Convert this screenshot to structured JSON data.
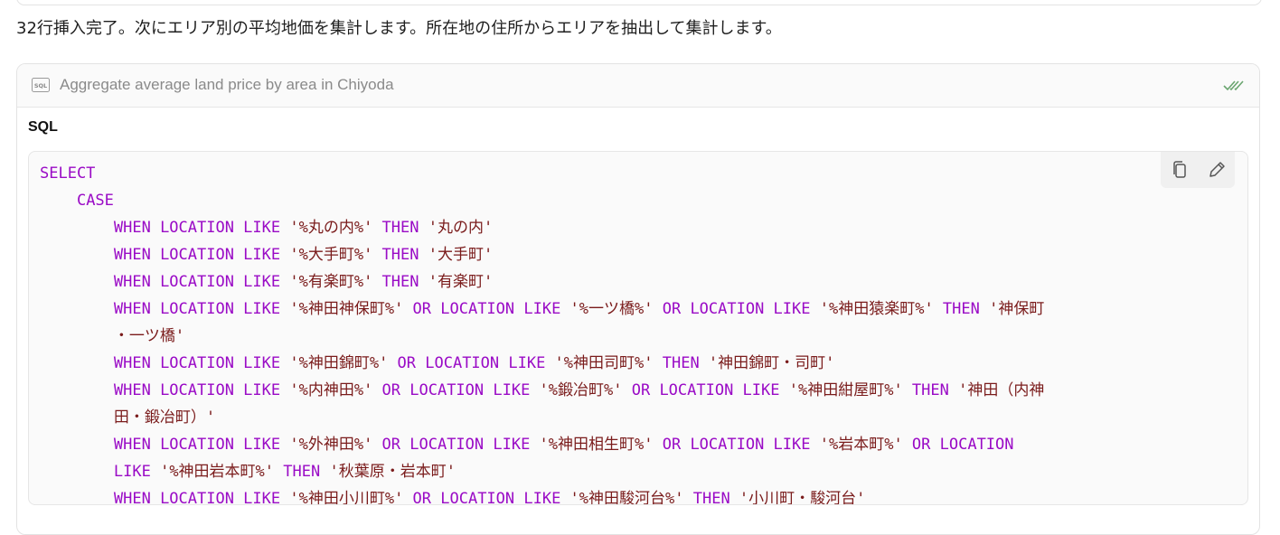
{
  "message": {
    "text": "32行挿入完了。次にエリア別の平均地価を集計します。所在地の住所からエリアを抽出して集計します。"
  },
  "tool_call": {
    "icon": "sql-icon",
    "title": "Aggregate average land price by area in Chiyoda",
    "status_icon": "double-check-icon",
    "section_label": "SQL",
    "actions": {
      "copy_icon": "copy-icon",
      "edit_icon": "edit-pencil-icon"
    }
  },
  "code": {
    "language": "SQL",
    "lines": [
      [
        {
          "t": "kw",
          "v": "SELECT"
        }
      ],
      [
        {
          "t": "kw",
          "v": "    CASE"
        }
      ],
      [
        {
          "t": "kw",
          "v": "        WHEN LOCATION LIKE "
        },
        {
          "t": "str",
          "v": "'%丸の内%'"
        },
        {
          "t": "kw",
          "v": " THEN "
        },
        {
          "t": "str",
          "v": "'丸の内'"
        }
      ],
      [
        {
          "t": "kw",
          "v": "        WHEN LOCATION LIKE "
        },
        {
          "t": "str",
          "v": "'%大手町%'"
        },
        {
          "t": "kw",
          "v": " THEN "
        },
        {
          "t": "str",
          "v": "'大手町'"
        }
      ],
      [
        {
          "t": "kw",
          "v": "        WHEN LOCATION LIKE "
        },
        {
          "t": "str",
          "v": "'%有楽町%'"
        },
        {
          "t": "kw",
          "v": " THEN "
        },
        {
          "t": "str",
          "v": "'有楽町'"
        }
      ],
      [
        {
          "t": "kw",
          "v": "        WHEN LOCATION LIKE "
        },
        {
          "t": "str",
          "v": "'%神田神保町%'"
        },
        {
          "t": "kw",
          "v": " OR LOCATION LIKE "
        },
        {
          "t": "str",
          "v": "'%一ツ橋%'"
        },
        {
          "t": "kw",
          "v": " OR LOCATION LIKE "
        },
        {
          "t": "str",
          "v": "'%神田猿楽町%'"
        },
        {
          "t": "kw",
          "v": " THEN "
        },
        {
          "t": "str",
          "v": "'神保町\n        ・一ツ橋'"
        }
      ],
      [
        {
          "t": "kw",
          "v": "        WHEN LOCATION LIKE "
        },
        {
          "t": "str",
          "v": "'%神田錦町%'"
        },
        {
          "t": "kw",
          "v": " OR LOCATION LIKE "
        },
        {
          "t": "str",
          "v": "'%神田司町%'"
        },
        {
          "t": "kw",
          "v": " THEN "
        },
        {
          "t": "str",
          "v": "'神田錦町・司町'"
        }
      ],
      [
        {
          "t": "kw",
          "v": "        WHEN LOCATION LIKE "
        },
        {
          "t": "str",
          "v": "'%内神田%'"
        },
        {
          "t": "kw",
          "v": " OR LOCATION LIKE "
        },
        {
          "t": "str",
          "v": "'%鍛冶町%'"
        },
        {
          "t": "kw",
          "v": " OR LOCATION LIKE "
        },
        {
          "t": "str",
          "v": "'%神田紺屋町%'"
        },
        {
          "t": "kw",
          "v": " THEN "
        },
        {
          "t": "str",
          "v": "'神田（内神\n        田・鍛冶町）'"
        }
      ],
      [
        {
          "t": "kw",
          "v": "        WHEN LOCATION LIKE "
        },
        {
          "t": "str",
          "v": "'%外神田%'"
        },
        {
          "t": "kw",
          "v": " OR LOCATION LIKE "
        },
        {
          "t": "str",
          "v": "'%神田相生町%'"
        },
        {
          "t": "kw",
          "v": " OR LOCATION LIKE "
        },
        {
          "t": "str",
          "v": "'%岩本町%'"
        },
        {
          "t": "kw",
          "v": " OR LOCATION\n        LIKE "
        },
        {
          "t": "str",
          "v": "'%神田岩本町%'"
        },
        {
          "t": "kw",
          "v": " THEN "
        },
        {
          "t": "str",
          "v": "'秋葉原・岩本町'"
        }
      ],
      [
        {
          "t": "kw",
          "v": "        WHEN LOCATION LIKE "
        },
        {
          "t": "str",
          "v": "'%神田小川町%'"
        },
        {
          "t": "kw",
          "v": " OR LOCATION LIKE "
        },
        {
          "t": "str",
          "v": "'%神田駿河台%'"
        },
        {
          "t": "kw",
          "v": " THEN "
        },
        {
          "t": "str",
          "v": "'小川町・駿河台'"
        }
      ]
    ]
  }
}
